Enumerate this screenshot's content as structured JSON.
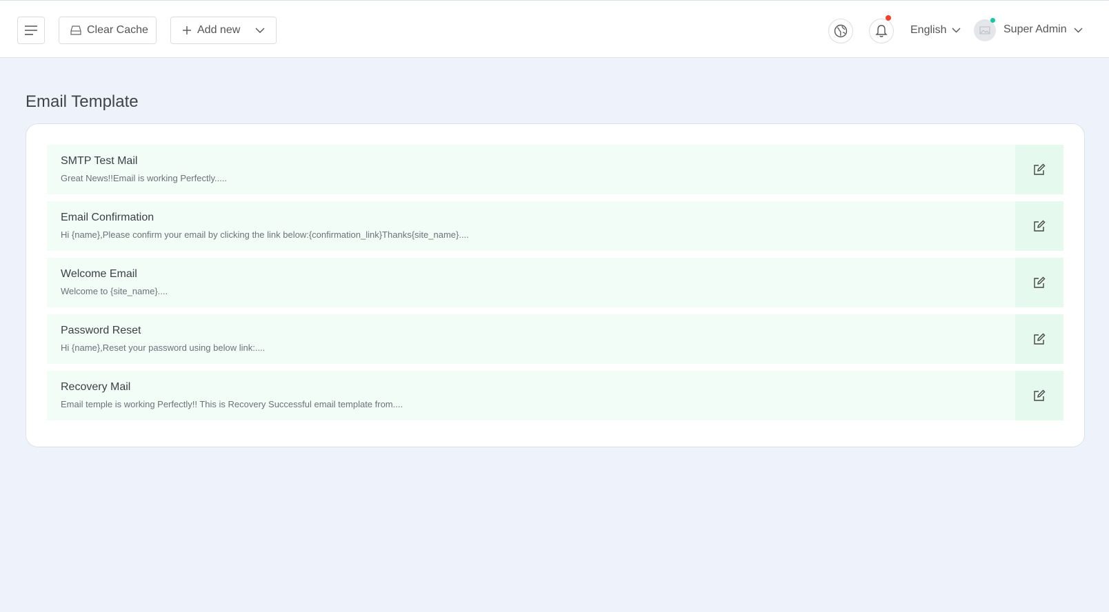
{
  "header": {
    "menu_icon": "hamburger-icon",
    "clear_cache_label": "Clear Cache",
    "add_new_label": "Add new",
    "language": "English",
    "user_name": "Super Admin",
    "notification_dot_color": "#f0412b",
    "online_dot_color": "#10c9a5"
  },
  "page": {
    "title": "Email Template"
  },
  "templates": [
    {
      "title": "SMTP Test Mail",
      "description": "Great News!!Email is working Perfectly....."
    },
    {
      "title": "Email Confirmation",
      "description": "Hi {name},Please confirm your email by clicking the link below:{confirmation_link}Thanks{site_name}...."
    },
    {
      "title": "Welcome Email",
      "description": "Welcome to {site_name}...."
    },
    {
      "title": "Password Reset",
      "description": "Hi {name},Reset your password using below link:...."
    },
    {
      "title": "Recovery Mail",
      "description": "Email temple is working Perfectly!! This is Recovery Successful email template from...."
    }
  ],
  "colors": {
    "row_background": "#f2fdf8",
    "edit_background": "#e5f9ef",
    "page_background": "#eef2fa"
  }
}
